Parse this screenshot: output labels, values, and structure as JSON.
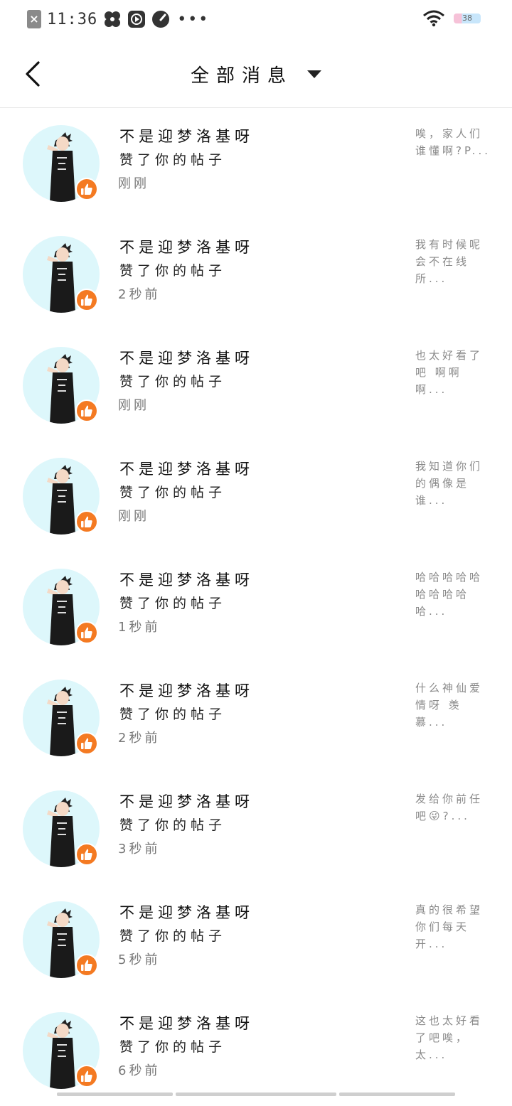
{
  "status_bar": {
    "time": "11:36",
    "battery": "38",
    "more": "•••"
  },
  "nav": {
    "title": "全部消息"
  },
  "messages": [
    {
      "name": "不是迎梦洛基呀",
      "action": "赞了你的帖子",
      "time": "刚刚",
      "preview": "唉，家人们谁懂啊?P..."
    },
    {
      "name": "不是迎梦洛基呀",
      "action": "赞了你的帖子",
      "time": "2秒前",
      "preview": "我有时候呢会不在线所..."
    },
    {
      "name": "不是迎梦洛基呀",
      "action": "赞了你的帖子",
      "time": "刚刚",
      "preview": "也太好看了吧 啊啊啊..."
    },
    {
      "name": "不是迎梦洛基呀",
      "action": "赞了你的帖子",
      "time": "刚刚",
      "preview": "我知道你们的偶像是谁..."
    },
    {
      "name": "不是迎梦洛基呀",
      "action": "赞了你的帖子",
      "time": "1秒前",
      "preview": "哈哈哈哈哈哈哈哈哈哈..."
    },
    {
      "name": "不是迎梦洛基呀",
      "action": "赞了你的帖子",
      "time": "2秒前",
      "preview": "什么神仙爱情呀 羡慕..."
    },
    {
      "name": "不是迎梦洛基呀",
      "action": "赞了你的帖子",
      "time": "3秒前",
      "preview": "发给你前任吧😜?..."
    },
    {
      "name": "不是迎梦洛基呀",
      "action": "赞了你的帖子",
      "time": "5秒前",
      "preview": "真的很希望你们每天开..."
    },
    {
      "name": "不是迎梦洛基呀",
      "action": "赞了你的帖子",
      "time": "6秒前",
      "preview": "这也太好看了吧唉，太..."
    }
  ]
}
